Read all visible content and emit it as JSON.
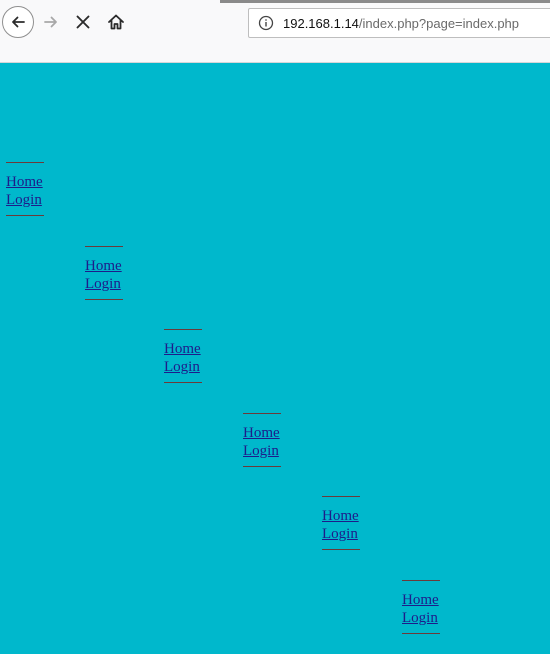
{
  "browser": {
    "url_host": "192.168.1.14",
    "url_path": "/index.php?page=index.php",
    "icons": {
      "back": "arrow-left-icon",
      "forward": "arrow-right-icon",
      "stop": "close-icon",
      "home": "home-icon",
      "info": "info-icon"
    }
  },
  "page": {
    "background": "#00b8cc",
    "link_color": "#1d1c8a",
    "nav_blocks": [
      {
        "home": "Home",
        "login": "Login"
      },
      {
        "home": "Home",
        "login": "Login"
      },
      {
        "home": "Home",
        "login": "Login"
      },
      {
        "home": "Home",
        "login": "Login"
      },
      {
        "home": "Home",
        "login": "Login"
      },
      {
        "home": "Home",
        "login": "Login"
      }
    ]
  }
}
